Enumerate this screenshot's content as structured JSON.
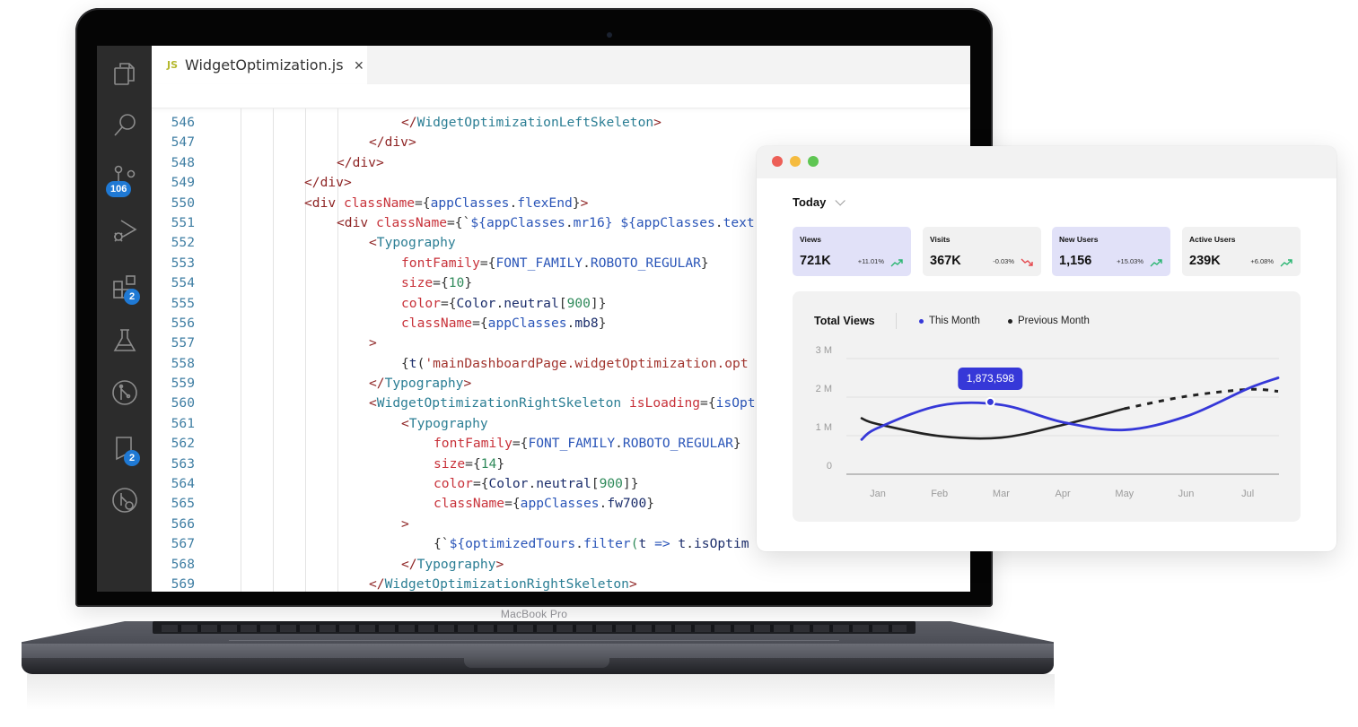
{
  "device": {
    "brand_label": "MacBook Pro"
  },
  "editor": {
    "activity_bar": [
      {
        "icon": "files-icon",
        "badge": null
      },
      {
        "icon": "search-icon",
        "badge": null
      },
      {
        "icon": "source-control-icon",
        "badge": "106"
      },
      {
        "icon": "run-debug-icon",
        "badge": null
      },
      {
        "icon": "extensions-icon",
        "badge": "2"
      },
      {
        "icon": "testing-icon",
        "badge": null
      },
      {
        "icon": "git-graph-icon",
        "badge": null
      },
      {
        "icon": "pull-requests-icon",
        "badge": "2"
      },
      {
        "icon": "remote-explorer-icon",
        "badge": null
      }
    ],
    "tab": {
      "lang": "JS",
      "filename": "WidgetOptimization.js",
      "close": "×"
    },
    "lines": [
      {
        "n": "546",
        "indent": 3,
        "tokens": [
          [
            "tag",
            "</"
          ],
          [
            "comp",
            "WidgetOptimizationLeftSkeleton"
          ],
          [
            "tag",
            ">"
          ]
        ]
      },
      {
        "n": "547",
        "indent": 2,
        "tokens": [
          [
            "tag",
            "</"
          ],
          [
            "tag",
            "div"
          ],
          [
            "tag",
            ">"
          ]
        ]
      },
      {
        "n": "548",
        "indent": 1,
        "tokens": [
          [
            "tag",
            "</"
          ],
          [
            "tag",
            "div"
          ],
          [
            "tag",
            ">"
          ]
        ]
      },
      {
        "n": "549",
        "indent": 0,
        "tokens": [
          [
            "tag",
            "</"
          ],
          [
            "tag",
            "div"
          ],
          [
            "tag",
            ">"
          ]
        ]
      },
      {
        "n": "550",
        "indent": 0,
        "tokens": [
          [
            "tag",
            "<div "
          ],
          [
            "attr",
            "className"
          ],
          [
            "pun",
            "={"
          ],
          [
            "val",
            "appClasses"
          ],
          [
            "pun",
            "."
          ],
          [
            "val",
            "flexEnd"
          ],
          [
            "pun",
            "}"
          ],
          [
            "tag",
            ">"
          ]
        ]
      },
      {
        "n": "551",
        "indent": 1,
        "tokens": [
          [
            "tag",
            "<div "
          ],
          [
            "attr",
            "className"
          ],
          [
            "pun",
            "={`"
          ],
          [
            "val",
            "${appClasses"
          ],
          [
            "pun",
            "."
          ],
          [
            "val",
            "mr16} ${appClasses"
          ],
          [
            "pun",
            "."
          ],
          [
            "val",
            "text"
          ]
        ]
      },
      {
        "n": "552",
        "indent": 2,
        "tokens": [
          [
            "tag",
            "<"
          ],
          [
            "comp",
            "Typography"
          ]
        ]
      },
      {
        "n": "553",
        "indent": 3,
        "tokens": [
          [
            "attr",
            "fontFamily"
          ],
          [
            "pun",
            "={"
          ],
          [
            "val",
            "FONT_FAMILY"
          ],
          [
            "pun",
            "."
          ],
          [
            "val",
            "ROBOTO_REGULAR"
          ],
          [
            "pun",
            "}"
          ]
        ]
      },
      {
        "n": "554",
        "indent": 3,
        "tokens": [
          [
            "attr",
            "size"
          ],
          [
            "pun",
            "={"
          ],
          [
            "num",
            "10"
          ],
          [
            "pun",
            "}"
          ]
        ]
      },
      {
        "n": "555",
        "indent": 3,
        "tokens": [
          [
            "attr",
            "color"
          ],
          [
            "pun",
            "={"
          ],
          [
            "obj",
            "Color"
          ],
          [
            "pun",
            "."
          ],
          [
            "obj",
            "neutral"
          ],
          [
            "pun",
            "["
          ],
          [
            "num",
            "900"
          ],
          [
            "pun",
            "]}"
          ]
        ]
      },
      {
        "n": "556",
        "indent": 3,
        "tokens": [
          [
            "attr",
            "className"
          ],
          [
            "pun",
            "={"
          ],
          [
            "val",
            "appClasses"
          ],
          [
            "pun",
            "."
          ],
          [
            "obj",
            "mb8"
          ],
          [
            "pun",
            "}"
          ]
        ]
      },
      {
        "n": "557",
        "indent": 2,
        "tokens": [
          [
            "tag",
            ">"
          ]
        ]
      },
      {
        "n": "558",
        "indent": 3,
        "tokens": [
          [
            "pun",
            "{"
          ],
          [
            "obj",
            "t"
          ],
          [
            "pun",
            "("
          ],
          [
            "str",
            "'mainDashboardPage.widgetOptimization.opt"
          ]
        ]
      },
      {
        "n": "559",
        "indent": 2,
        "tokens": [
          [
            "tag",
            "</"
          ],
          [
            "comp",
            "Typography"
          ],
          [
            "tag",
            ">"
          ]
        ]
      },
      {
        "n": "560",
        "indent": 2,
        "tokens": [
          [
            "tag",
            "<"
          ],
          [
            "comp",
            "WidgetOptimizationRightSkeleton "
          ],
          [
            "attr",
            "isLoading"
          ],
          [
            "pun",
            "={"
          ],
          [
            "val",
            "isOpt"
          ]
        ]
      },
      {
        "n": "561",
        "indent": 3,
        "tokens": [
          [
            "tag",
            "<"
          ],
          [
            "comp",
            "Typography"
          ]
        ]
      },
      {
        "n": "562",
        "indent": 4,
        "tokens": [
          [
            "attr",
            "fontFamily"
          ],
          [
            "pun",
            "={"
          ],
          [
            "val",
            "FONT_FAMILY"
          ],
          [
            "pun",
            "."
          ],
          [
            "val",
            "ROBOTO_REGULAR"
          ],
          [
            "pun",
            "}"
          ]
        ]
      },
      {
        "n": "563",
        "indent": 4,
        "tokens": [
          [
            "attr",
            "size"
          ],
          [
            "pun",
            "={"
          ],
          [
            "num",
            "14"
          ],
          [
            "pun",
            "}"
          ]
        ]
      },
      {
        "n": "564",
        "indent": 4,
        "tokens": [
          [
            "attr",
            "color"
          ],
          [
            "pun",
            "={"
          ],
          [
            "obj",
            "Color"
          ],
          [
            "pun",
            "."
          ],
          [
            "obj",
            "neutral"
          ],
          [
            "pun",
            "["
          ],
          [
            "num",
            "900"
          ],
          [
            "pun",
            "]}"
          ]
        ]
      },
      {
        "n": "565",
        "indent": 4,
        "tokens": [
          [
            "attr",
            "className"
          ],
          [
            "pun",
            "={"
          ],
          [
            "val",
            "appClasses"
          ],
          [
            "pun",
            "."
          ],
          [
            "obj",
            "fw700"
          ],
          [
            "pun",
            "}"
          ]
        ]
      },
      {
        "n": "566",
        "indent": 3,
        "tokens": [
          [
            "tag",
            ">"
          ]
        ]
      },
      {
        "n": "567",
        "indent": 4,
        "tokens": [
          [
            "pun",
            "{`"
          ],
          [
            "val",
            "${optimizedTours"
          ],
          [
            "pun",
            "."
          ],
          [
            "val",
            "filter"
          ],
          [
            "num",
            "("
          ],
          [
            "obj",
            "t "
          ],
          [
            "val",
            "=>"
          ],
          [
            "obj",
            " t"
          ],
          [
            "pun",
            "."
          ],
          [
            "obj",
            "isOptim"
          ]
        ]
      },
      {
        "n": "568",
        "indent": 3,
        "tokens": [
          [
            "tag",
            "</"
          ],
          [
            "comp",
            "Typography"
          ],
          [
            "tag",
            ">"
          ]
        ]
      },
      {
        "n": "569",
        "indent": 2,
        "tokens": [
          [
            "tag",
            "</"
          ],
          [
            "comp",
            "WidgetOptimizationRightSkeleton"
          ],
          [
            "tag",
            ">"
          ]
        ]
      }
    ]
  },
  "dashboard": {
    "traffic_lights": {
      "close": "#ed5f57",
      "minimize": "#f5bb3f",
      "maximize": "#5fc653"
    },
    "period": {
      "selected": "Today"
    },
    "stats": [
      {
        "title": "Views",
        "value": "721K",
        "change": "+11.01%",
        "trend": "up",
        "highlighted": true
      },
      {
        "title": "Visits",
        "value": "367K",
        "change": "-0.03%",
        "trend": "down",
        "highlighted": false
      },
      {
        "title": "New Users",
        "value": "1,156",
        "change": "+15.03%",
        "trend": "up",
        "highlighted": true
      },
      {
        "title": "Active Users",
        "value": "239K",
        "change": "+6.08%",
        "trend": "up",
        "highlighted": false
      }
    ],
    "colors": {
      "highlight_bg": "#e1e1f8",
      "neutral_bg": "#f1f1f1",
      "up": "#2bb673",
      "down": "#e5484d",
      "accent": "#3638d8",
      "previous": "#222222"
    }
  },
  "chart_data": {
    "type": "line",
    "title": "Total Views",
    "x": [
      "Jan",
      "Feb",
      "Mar",
      "Apr",
      "May",
      "Jun",
      "Jul"
    ],
    "yticks": [
      "0",
      "1 M",
      "2 M",
      "3 M"
    ],
    "ylim": [
      0,
      3000000
    ],
    "grid": true,
    "legend_position": "top",
    "series": [
      {
        "name": "This Month",
        "color": "#3638d8",
        "style": "solid",
        "values": [
          1200000,
          1780000,
          1800000,
          1350000,
          1150000,
          1500000,
          2220000
        ],
        "start": 900000,
        "end": 2500000
      },
      {
        "name": "Previous Month",
        "color": "#222222",
        "style": "solid-then-dotted",
        "dotted_from": "May",
        "values": [
          1300000,
          990000,
          950000,
          1280000,
          1700000,
          2020000,
          2200000
        ],
        "start": 1450000,
        "end": 2150000
      }
    ],
    "annotation": {
      "label": "1,873,598",
      "x": "Mar",
      "value": 1873598
    }
  }
}
